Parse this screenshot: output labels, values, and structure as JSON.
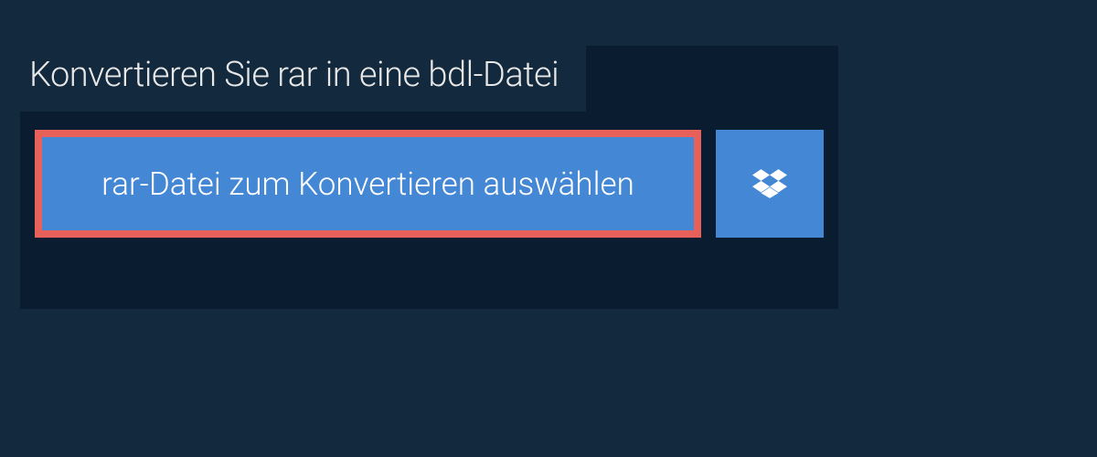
{
  "title": "Konvertieren Sie rar in eine bdl-Datei",
  "buttons": {
    "select_file_label": "rar-Datei zum Konvertieren auswählen"
  },
  "colors": {
    "background": "#13293d",
    "panel": "#0a1d30",
    "button": "#4487d5",
    "highlight_border": "#e7605a",
    "text_light": "#e8e8e8",
    "text_white": "#ffffff"
  }
}
